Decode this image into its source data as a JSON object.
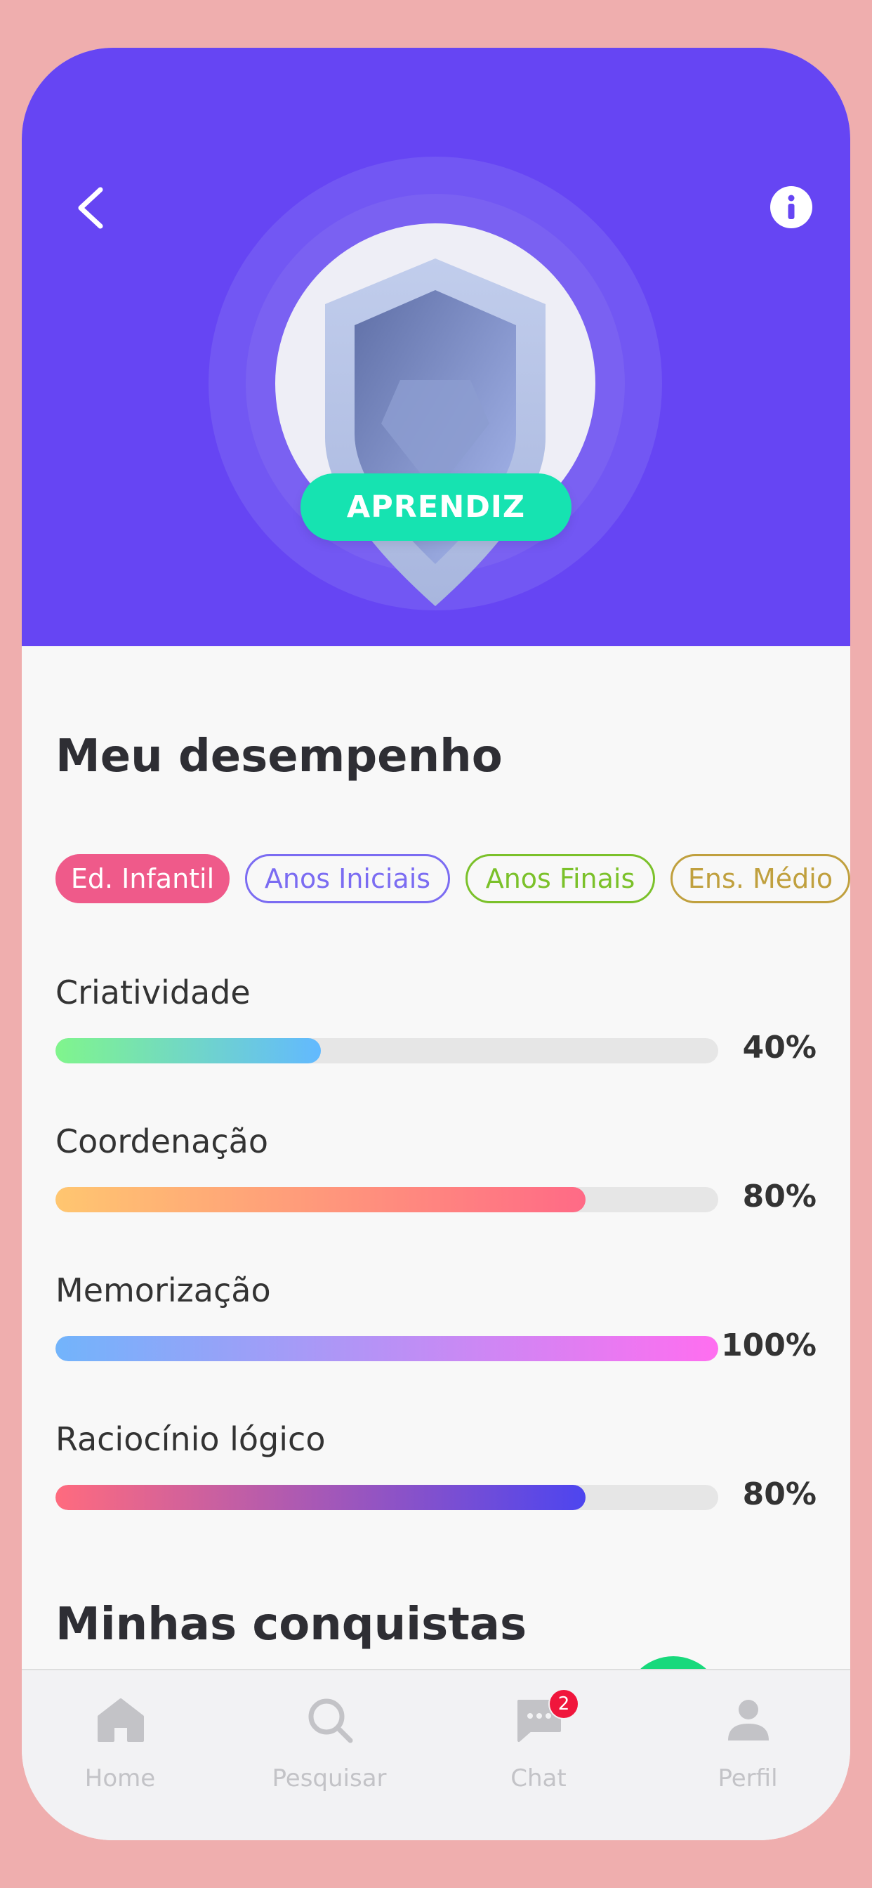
{
  "header": {
    "level_label": "APRENDIZ",
    "back_icon": "chevron-left-icon",
    "info_icon": "info-icon",
    "background_color": "#6645f3"
  },
  "performance": {
    "title": "Meu desempenho",
    "filters": [
      {
        "label": "Ed. Infantil",
        "selected": true,
        "color": "#ef5a8a"
      },
      {
        "label": "Anos Iniciais",
        "selected": false,
        "color": "#7b6cf2"
      },
      {
        "label": "Anos Finais",
        "selected": false,
        "color": "#7bc12a"
      },
      {
        "label": "Ens. Médio",
        "selected": false,
        "color": "#c0a03e"
      }
    ],
    "metrics": [
      {
        "label": "Criatividade",
        "value": 40,
        "display": "40%",
        "gradient": [
          "#80f58c",
          "#62b9ff"
        ]
      },
      {
        "label": "Coordenação",
        "value": 80,
        "display": "80%",
        "gradient": [
          "#ffc670",
          "#ff6a86"
        ]
      },
      {
        "label": "Memorização",
        "value": 100,
        "display": "100%",
        "gradient": [
          "#72b4fb",
          "#ff6ef0"
        ]
      },
      {
        "label": "Raciocínio lógico",
        "value": 80,
        "display": "80%",
        "gradient": [
          "#ff6b7e",
          "#4d45ef"
        ]
      }
    ]
  },
  "achievements": {
    "title": "Minhas conquistas"
  },
  "bottom_nav": {
    "items": [
      {
        "label": "Home",
        "icon": "home-icon"
      },
      {
        "label": "Pesquisar",
        "icon": "search-icon"
      },
      {
        "label": "Chat",
        "icon": "chat-icon",
        "badge": "2"
      },
      {
        "label": "Perfil",
        "icon": "user-icon"
      }
    ]
  }
}
